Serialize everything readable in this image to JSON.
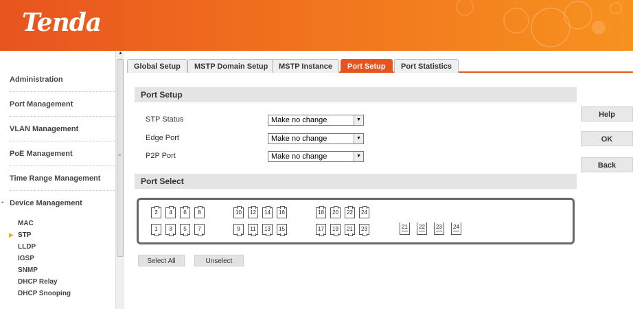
{
  "brand": {
    "logo": "Tenda",
    "accent": "#e8541f"
  },
  "sidebar": {
    "items": [
      {
        "label": "Administration"
      },
      {
        "label": "Port Management"
      },
      {
        "label": "VLAN Management"
      },
      {
        "label": "PoE Management"
      },
      {
        "label": "Time Range Management"
      },
      {
        "label": "Device Management"
      }
    ],
    "subitems": [
      {
        "label": "MAC"
      },
      {
        "label": "STP",
        "active": true
      },
      {
        "label": "LLDP"
      },
      {
        "label": "IGSP"
      },
      {
        "label": "SNMP"
      },
      {
        "label": "DHCP Relay"
      },
      {
        "label": "DHCP Snooping"
      }
    ]
  },
  "tabs": [
    {
      "label": "Global Setup"
    },
    {
      "label": "MSTP Domain Setup"
    },
    {
      "label": "MSTP Instance"
    },
    {
      "label": "Port Setup",
      "active": true
    },
    {
      "label": "Port Statistics"
    }
  ],
  "port_setup": {
    "title": "Port Setup",
    "fields": [
      {
        "label": "STP Status",
        "value": "Make no change"
      },
      {
        "label": "Edge Port",
        "value": "Make no change"
      },
      {
        "label": "P2P Port",
        "value": "Make no change"
      }
    ]
  },
  "port_select": {
    "title": "Port Select",
    "top_row": [
      "2",
      "4",
      "6",
      "8",
      "10",
      "12",
      "14",
      "16",
      "18",
      "20",
      "22",
      "24"
    ],
    "bottom_row": [
      "1",
      "3",
      "5",
      "7",
      "9",
      "11",
      "13",
      "15",
      "17",
      "19",
      "21",
      "23"
    ],
    "sfp_ports": [
      "21",
      "22",
      "23",
      "24"
    ],
    "select_all": "Select All",
    "unselect": "Unselect"
  },
  "actions": {
    "help": "Help",
    "ok": "OK",
    "back": "Back"
  }
}
